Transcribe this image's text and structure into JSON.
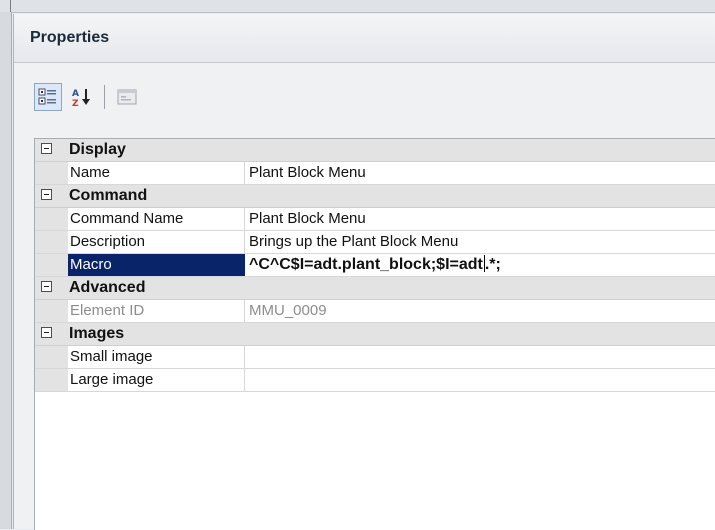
{
  "panel": {
    "title": "Properties"
  },
  "toolbar": {
    "buttons": [
      {
        "icon": "categorized-icon",
        "active": true
      },
      {
        "icon": "alphabetical-sort-icon",
        "active": false
      },
      {
        "icon": "property-pages-icon",
        "active": false
      }
    ]
  },
  "grid": {
    "categories": [
      {
        "name": "Display",
        "rows": [
          {
            "name": "Name",
            "value": "Plant Block Menu"
          }
        ]
      },
      {
        "name": "Command",
        "rows": [
          {
            "name": "Command Name",
            "value": "Plant Block Menu"
          },
          {
            "name": "Description",
            "value": "Brings up the Plant Block Menu"
          },
          {
            "name": "Macro",
            "value_before_caret": "^C^C$I=adt.plant_block;$I=adt",
            "value_after_caret": ".*;"
          }
        ]
      },
      {
        "name": "Advanced",
        "rows": [
          {
            "name": "Element ID",
            "value": "MMU_0009"
          }
        ]
      },
      {
        "name": "Images",
        "rows": [
          {
            "name": "Small image",
            "value": ""
          },
          {
            "name": "Large image",
            "value": ""
          }
        ]
      }
    ]
  },
  "colors": {
    "selection": "#0a246a",
    "category_band": "#e3e3e3",
    "disabled_text": "#8d8d8d"
  }
}
